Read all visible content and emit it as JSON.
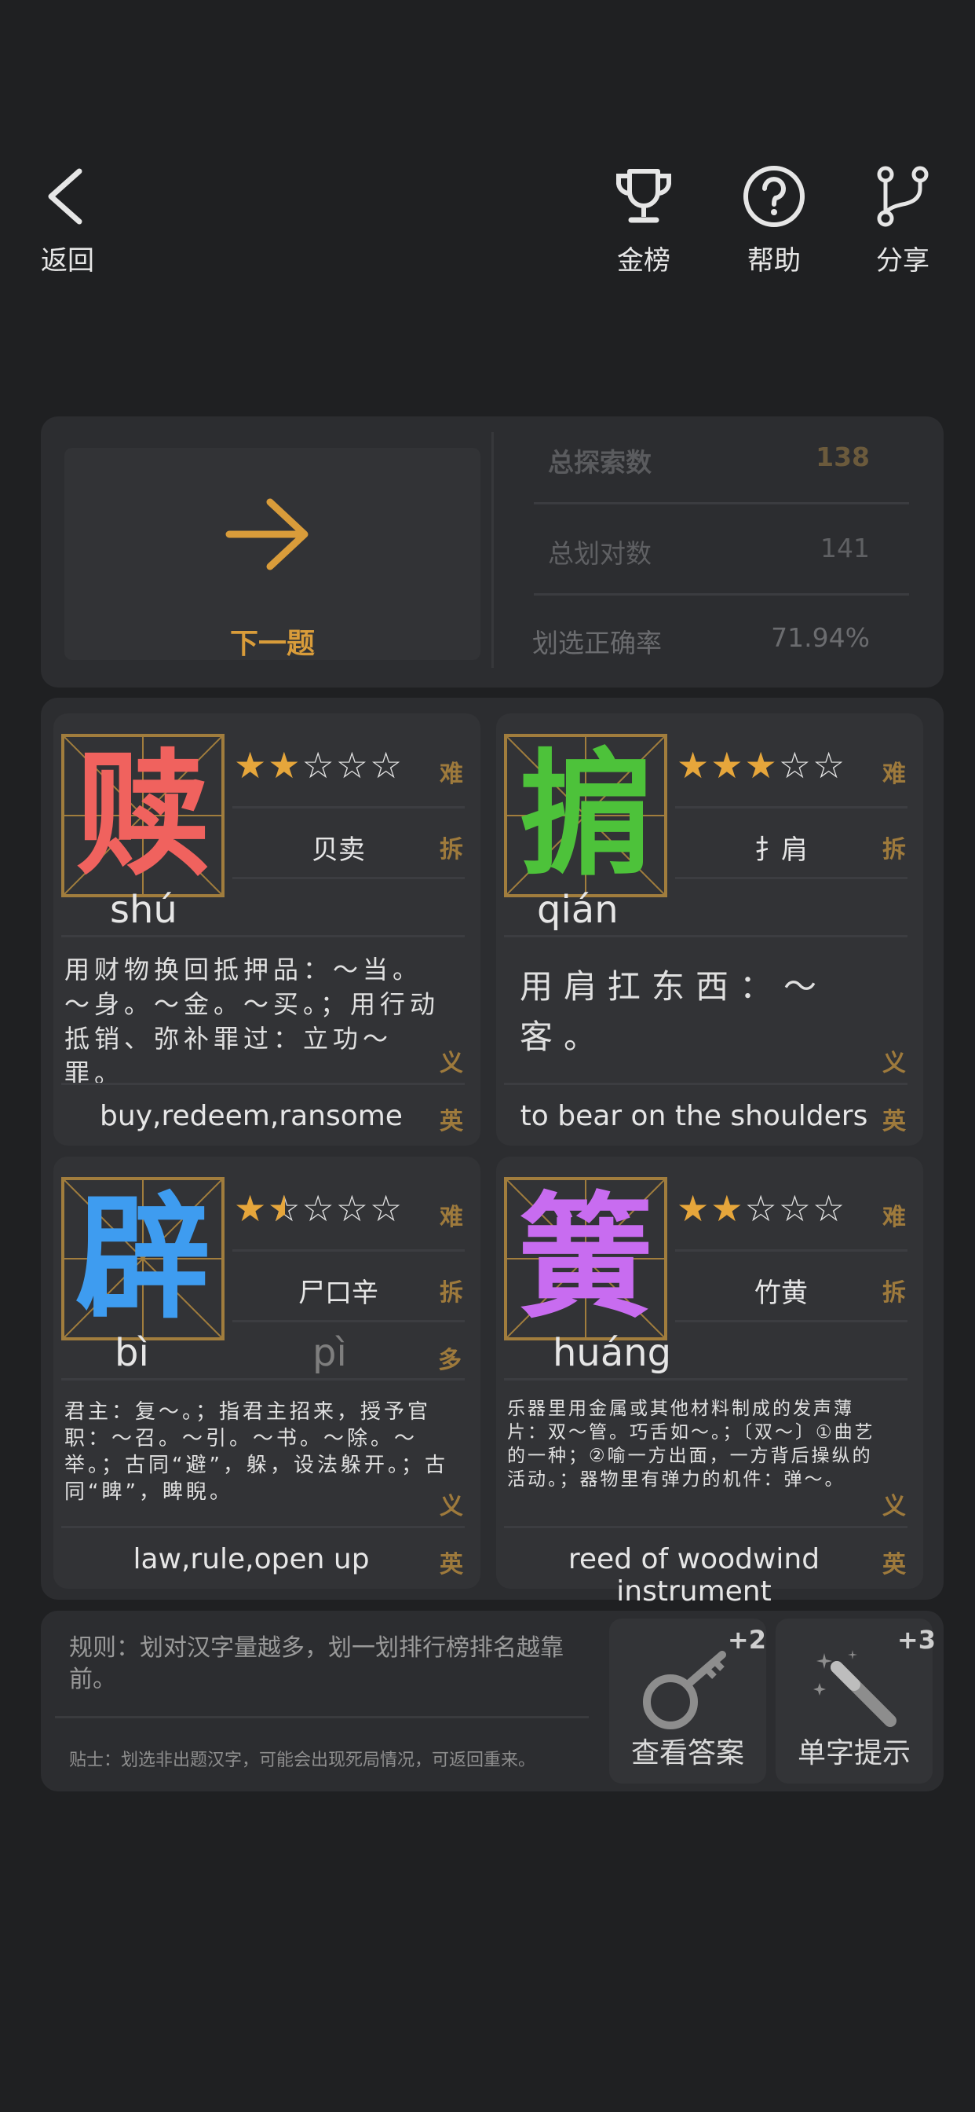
{
  "header": {
    "back_label": "返回",
    "rank_label": "金榜",
    "help_label": "帮助",
    "share_label": "分享"
  },
  "next": {
    "label": "下一题"
  },
  "stats": [
    {
      "key": "总探索数",
      "value": "138"
    },
    {
      "key": "总划对数",
      "value": "141"
    },
    {
      "key": "划选正确率",
      "value": "71.94%"
    }
  ],
  "tags": {
    "difficulty": "难",
    "split": "拆",
    "meaning": "义",
    "english": "英",
    "polyphone": "多"
  },
  "cards": [
    {
      "char": "赎",
      "color": "#f0625e",
      "stars": 2,
      "decomp": "贝卖",
      "pinyin": "shú",
      "meaning": "用财物换回抵押品：～当。～身。～金。～买。；用行动抵销、弥补罪过：立功～罪。",
      "english": "buy,redeem,ransome"
    },
    {
      "char": "掮",
      "color": "#4dc23a",
      "stars": 3,
      "decomp": "扌肩",
      "pinyin": "qián",
      "meaning": "用肩扛东西：～客。",
      "english": "to bear on the shoulders"
    },
    {
      "char": "辟",
      "color": "#3e9cf0",
      "stars": 1.5,
      "decomp": "尸口辛",
      "pinyin": "bì",
      "pinyin2": "pì",
      "meaning": "君主：复～。；指君主招来，授予官职：～召。～引。～书。～除。～举。；古同“避”，躲，设法躲开。；古同“睥”，睥睨。",
      "english": "law,rule,open up"
    },
    {
      "char": "簧",
      "color": "#c86cf0",
      "stars": 2,
      "decomp": "竹黄",
      "pinyin": "huáng",
      "meaning": "乐器里用金属或其他材料制成的发声薄片：双～管。巧舌如～。；〔双～〕①曲艺的一种；②喻一方出面，一方背后操纵的活动。；器物里有弹力的机件：弹～。",
      "english": "reed of woodwind instrument"
    }
  ],
  "rules": {
    "rule": "规则：划对汉字量越多，划一划排行榜排名越靠前。",
    "tip": "贴士：划选非出题汉字，可能会出现死局情况，可返回重来。"
  },
  "tools": [
    {
      "label": "查看答案",
      "bonus": "+2",
      "icon": "key-icon"
    },
    {
      "label": "单字提示",
      "bonus": "+3",
      "icon": "magic-wand-icon"
    }
  ]
}
